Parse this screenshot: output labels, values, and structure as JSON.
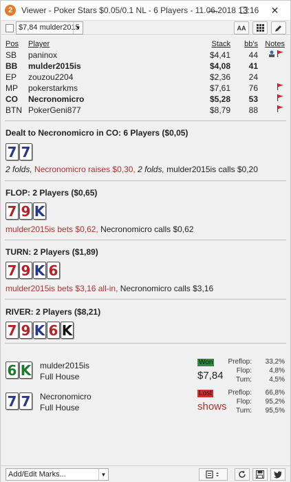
{
  "titlebar": {
    "app_icon": "2",
    "title": "Viewer - Poker Stars $0.05/0.1 NL - 6 Players - 11.06.2018 13:16",
    "min": "—",
    "max": "☐",
    "close": "✕"
  },
  "toolbar": {
    "hand_select": "$7,84 mulder2015",
    "font_btn": "AA"
  },
  "table": {
    "headers": {
      "pos": "Pos",
      "player": "Player",
      "stack": "Stack",
      "bbs": "bb's",
      "notes": "Notes"
    },
    "rows": [
      {
        "pos": "SB",
        "player": "paninox",
        "stack": "$4,41",
        "bbs": "44"
      },
      {
        "pos": "BB",
        "player": "mulder2015is",
        "stack": "$4,08",
        "bbs": "41"
      },
      {
        "pos": "EP",
        "player": "zouzou2204",
        "stack": "$2,36",
        "bbs": "24"
      },
      {
        "pos": "MP",
        "player": "pokerstarkms",
        "stack": "$7,61",
        "bbs": "76"
      },
      {
        "pos": "CO",
        "player": "Necronomicro",
        "stack": "$5,28",
        "bbs": "53"
      },
      {
        "pos": "BTN",
        "player": "PokerGeni877",
        "stack": "$8,79",
        "bbs": "88"
      }
    ]
  },
  "preflop": {
    "title": "Dealt to Necronomicro in CO: 6 Players ($0,05)",
    "cards": [
      "7",
      "7"
    ],
    "a1": "2 folds, ",
    "a2": "Necronomicro raises $0,30, ",
    "a3": "2 folds, ",
    "a4": "mulder2015is calls $0,20"
  },
  "flop": {
    "title": "FLOP: 2 Players ($0,65)",
    "cards": [
      "7",
      "9",
      "K"
    ],
    "a1": "mulder2015is bets $0,62, ",
    "a2": "Necronomicro calls $0,62"
  },
  "turn": {
    "title": "TURN: 2 Players ($1,89)",
    "cards": [
      "7",
      "9",
      "K",
      "6"
    ],
    "a1": "mulder2015is bets $3,16 all-in, ",
    "a2": "Necronomicro calls $3,16"
  },
  "river": {
    "title": "RIVER: 2 Players ($8,21)",
    "cards": [
      "7",
      "9",
      "K",
      "6",
      "K"
    ]
  },
  "results": [
    {
      "cards": [
        "6",
        "K"
      ],
      "name": "mulder2015is",
      "hand": "Full House",
      "badge": "Won",
      "value": "$7,84",
      "stats": [
        {
          "l": "Preflop:",
          "v": "33,2%"
        },
        {
          "l": "Flop:",
          "v": "4,8%"
        },
        {
          "l": "Turn:",
          "v": "4,5%"
        }
      ]
    },
    {
      "cards": [
        "7",
        "7"
      ],
      "name": "Necronomicro",
      "hand": "Full House",
      "badge": "Lost",
      "value": "shows",
      "stats": [
        {
          "l": "Preflop:",
          "v": "66,8%"
        },
        {
          "l": "Flop:",
          "v": "95,2%"
        },
        {
          "l": "Turn:",
          "v": "95,5%"
        }
      ]
    }
  ],
  "bottombar": {
    "marks": "Add/Edit Marks..."
  }
}
